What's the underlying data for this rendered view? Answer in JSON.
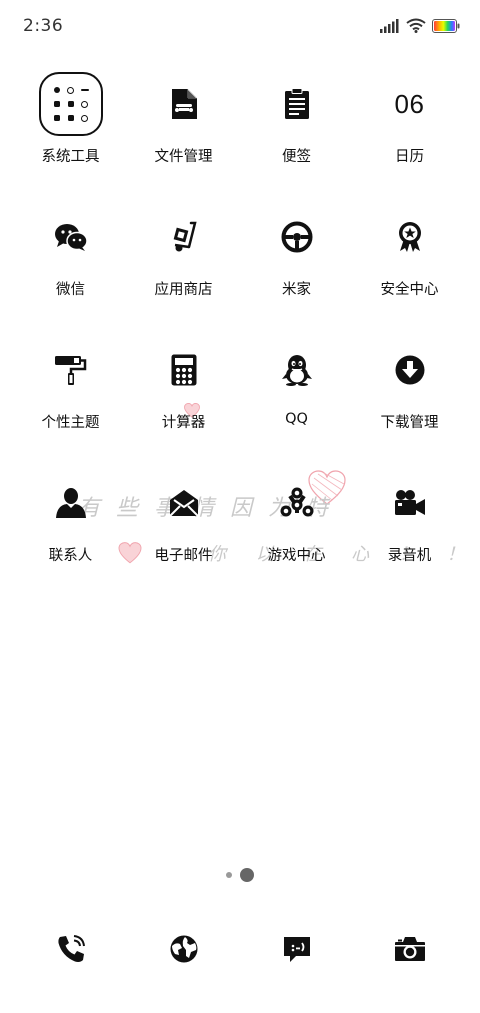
{
  "status": {
    "time": "2:36"
  },
  "rows": [
    {
      "apps": [
        {
          "name": "folder-system-tools",
          "label": "系统工具"
        },
        {
          "name": "file-manager",
          "label": "文件管理"
        },
        {
          "name": "notes",
          "label": "便签"
        },
        {
          "name": "calendar",
          "label": "日历",
          "icon_text": "06"
        }
      ]
    },
    {
      "apps": [
        {
          "name": "wechat",
          "label": "微信"
        },
        {
          "name": "app-store",
          "label": "应用商店"
        },
        {
          "name": "mi-home",
          "label": "米家"
        },
        {
          "name": "security-center",
          "label": "安全中心"
        }
      ]
    },
    {
      "apps": [
        {
          "name": "themes",
          "label": "个性主题"
        },
        {
          "name": "calculator",
          "label": "计算器"
        },
        {
          "name": "qq",
          "label": "QQ"
        },
        {
          "name": "downloads",
          "label": "下载管理"
        }
      ]
    },
    {
      "apps": [
        {
          "name": "contacts",
          "label": "联系人"
        },
        {
          "name": "email",
          "label": "电子邮件"
        },
        {
          "name": "game-center",
          "label": "游戏中心"
        },
        {
          "name": "recorder",
          "label": "录音机"
        }
      ]
    }
  ],
  "wallpaper": {
    "line1": "有些事情因为特",
    "line2": "你 以 在 心 ！ ！"
  },
  "colors": {
    "icon": "#111111",
    "background": "#ffffff",
    "heart": "#f2a0a8"
  }
}
